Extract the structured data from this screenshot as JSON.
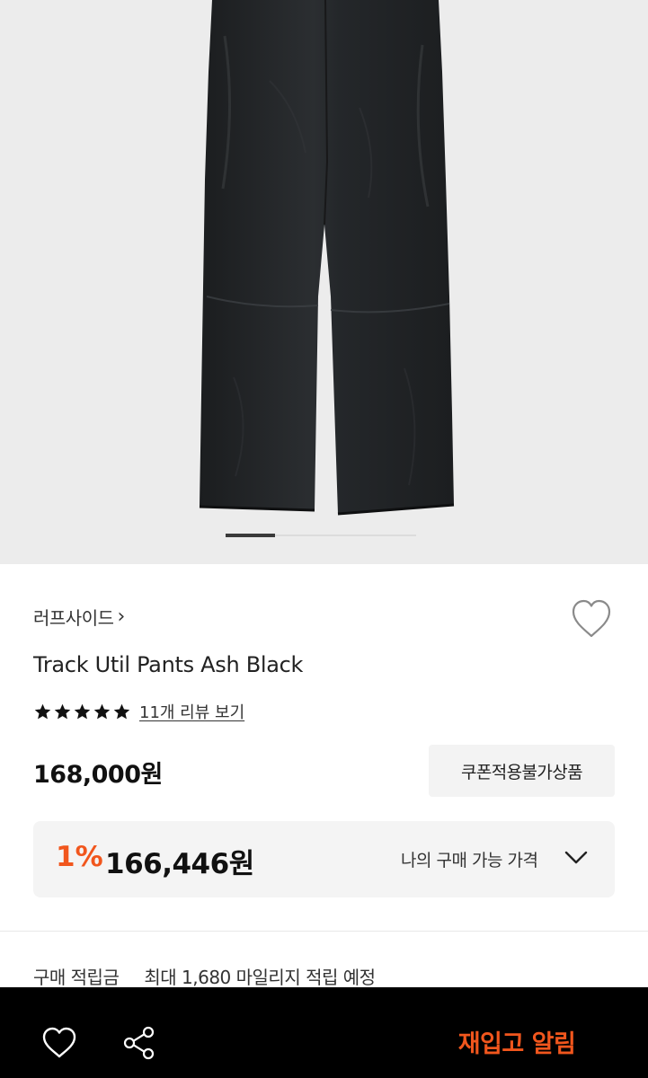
{
  "product": {
    "image_icon": "black-track-pants-image",
    "brand": "러프사이드",
    "brand_chevron": "›",
    "title": "Track Util Pants Ash Black",
    "rating_stars": 5,
    "review_link": "11개 리뷰 보기",
    "price": "168,000원",
    "coupon_badge": "쿠폰적용불가상품"
  },
  "my_price": {
    "discount": "1%",
    "value": "166,446원",
    "label": "나의 구매 가능 가격"
  },
  "points": {
    "label": "구매 적립금",
    "value": "최대 1,680 마일리지 적립 예정"
  },
  "bottom_bar": {
    "restock_label": "재입고 알림"
  },
  "colors": {
    "accent": "#f1561d",
    "bar": "#000000",
    "box": "#f4f4f4"
  }
}
